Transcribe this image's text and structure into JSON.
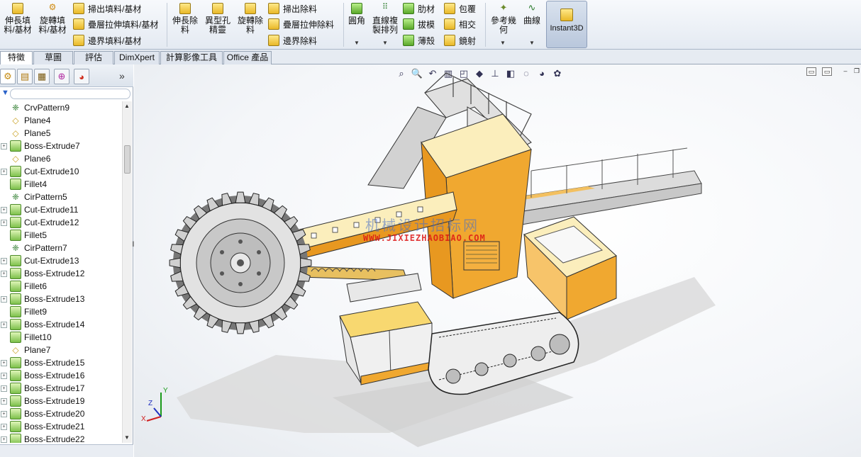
{
  "ribbon": {
    "extrude_boss": "伸長填\n料/基材",
    "revolve_boss": "旋轉填\n料/基材",
    "swept_boss": "掃出填料/基材",
    "loft_boss": "疊層拉伸填料/基材",
    "boundary_boss": "邊界填料/基材",
    "extrude_cut": "伸長除\n料",
    "hole_wizard": "異型孔\n精靈",
    "revolve_cut": "旋轉除\n料",
    "swept_cut": "掃出除料",
    "loft_cut": "疊層拉伸除料",
    "boundary_cut": "邊界除料",
    "fillet": "圓角",
    "linear_pattern": "直線複\n製排列",
    "rib": "肋材",
    "draft": "拔模",
    "shell": "薄殼",
    "wrap": "包覆",
    "intersect": "相交",
    "mirror": "鏡射",
    "ref_geometry": "參考幾\n何",
    "curves": "曲線",
    "instant3d": "Instant3D"
  },
  "tabs": [
    "特徵",
    "草圖",
    "評估",
    "DimXpert",
    "計算影像工具",
    "Office 產品"
  ],
  "tree": [
    {
      "label": "CrvPattern9",
      "icon": "pattern-icon",
      "exp": false
    },
    {
      "label": "Plane4",
      "icon": "plane-icon",
      "exp": false
    },
    {
      "label": "Plane5",
      "icon": "plane-icon",
      "exp": false
    },
    {
      "label": "Boss-Extrude7",
      "icon": "extrude-icon",
      "exp": true
    },
    {
      "label": "Plane6",
      "icon": "plane-icon",
      "exp": false
    },
    {
      "label": "Cut-Extrude10",
      "icon": "extrude-icon",
      "exp": true
    },
    {
      "label": "Fillet4",
      "icon": "fillet-icon",
      "exp": false
    },
    {
      "label": "CirPattern5",
      "icon": "pattern-icon",
      "exp": false
    },
    {
      "label": "Cut-Extrude11",
      "icon": "extrude-icon",
      "exp": true
    },
    {
      "label": "Cut-Extrude12",
      "icon": "extrude-icon",
      "exp": true
    },
    {
      "label": "Fillet5",
      "icon": "fillet-icon",
      "exp": false
    },
    {
      "label": "CirPattern7",
      "icon": "pattern-icon",
      "exp": false
    },
    {
      "label": "Cut-Extrude13",
      "icon": "extrude-icon",
      "exp": true
    },
    {
      "label": "Boss-Extrude12",
      "icon": "extrude-icon",
      "exp": true
    },
    {
      "label": "Fillet6",
      "icon": "fillet-icon",
      "exp": false
    },
    {
      "label": "Boss-Extrude13",
      "icon": "extrude-icon",
      "exp": true
    },
    {
      "label": "Fillet9",
      "icon": "fillet-icon",
      "exp": false
    },
    {
      "label": "Boss-Extrude14",
      "icon": "extrude-icon",
      "exp": true
    },
    {
      "label": "Fillet10",
      "icon": "fillet-icon",
      "exp": false
    },
    {
      "label": "Plane7",
      "icon": "plane-icon",
      "exp": false
    },
    {
      "label": "Boss-Extrude15",
      "icon": "extrude-icon",
      "exp": true
    },
    {
      "label": "Boss-Extrude16",
      "icon": "extrude-icon",
      "exp": true
    },
    {
      "label": "Boss-Extrude17",
      "icon": "extrude-icon",
      "exp": true
    },
    {
      "label": "Boss-Extrude19",
      "icon": "extrude-icon",
      "exp": true
    },
    {
      "label": "Boss-Extrude20",
      "icon": "extrude-icon",
      "exp": true
    },
    {
      "label": "Boss-Extrude21",
      "icon": "extrude-icon",
      "exp": true
    },
    {
      "label": "Boss-Extrude22",
      "icon": "extrude-icon",
      "exp": true
    }
  ],
  "watermark": {
    "cn": "机械设计招标网",
    "url": "WWW.JIXIEZHAOBIAO.COM"
  },
  "triad": {
    "x": "X",
    "y": "Y",
    "z": "Z"
  },
  "colors": {
    "accent": "#f0a830",
    "body": "#fbeebc",
    "frame": "#d8d8d8"
  }
}
